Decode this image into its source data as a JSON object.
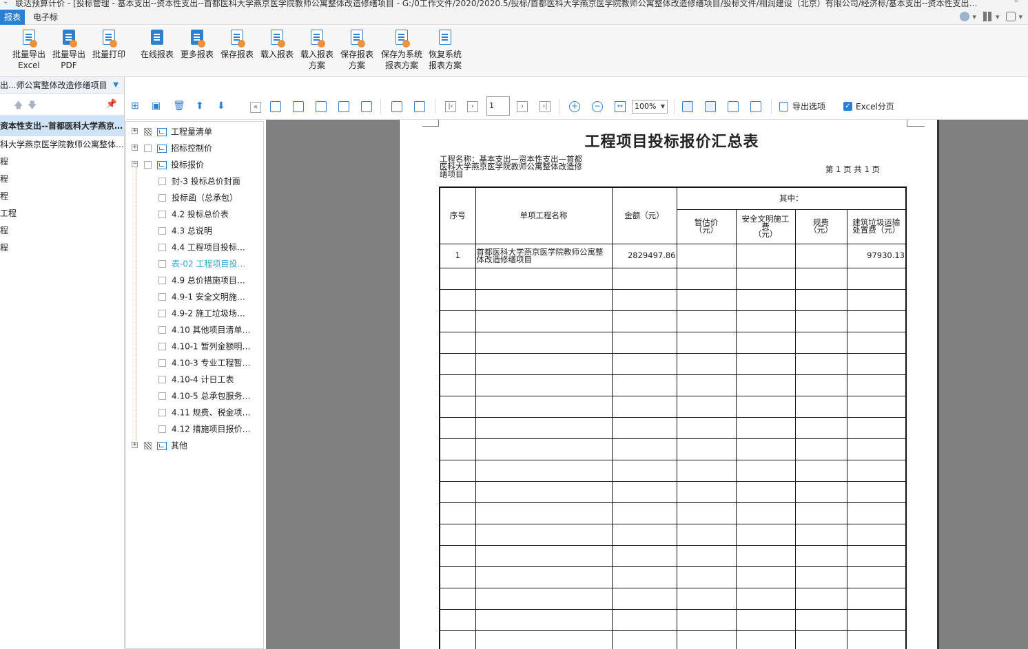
{
  "titlebar": {
    "title": "联达预算计价 - [投标管理 - 基本支出--资本性支出--首都医科大学燕京医学院教师公寓整体改造修缮项目 - G:/0工作文件/2020/2020.5/投标/首都医科大学燕京医学院教师公寓整体改造修缮项目/投标文件/相润建设（北京）有限公司/经济标/基本支出--资本性支出…",
    "minimize": "–"
  },
  "menu": {
    "tab_active": "报表",
    "tab_2": "电子标"
  },
  "ribbon": {
    "buttons": [
      {
        "label1": "批量导出",
        "label2": "Excel"
      },
      {
        "label1": "批量导出",
        "label2": "PDF"
      },
      {
        "label1": "批量打印",
        "label2": ""
      },
      {
        "label1": "在线报表",
        "label2": ""
      },
      {
        "label1": "更多报表",
        "label2": ""
      },
      {
        "label1": "保存报表",
        "label2": ""
      },
      {
        "label1": "载入报表",
        "label2": ""
      },
      {
        "label1": "载入报表",
        "label2": "方案"
      },
      {
        "label1": "保存报表",
        "label2": "方案"
      },
      {
        "label1": "保存为系统",
        "label2": "报表方案"
      },
      {
        "label1": "恢复系统",
        "label2": "报表方案"
      }
    ]
  },
  "left_panel": {
    "header": "出...师公寓整体改造修缮项目",
    "rows": [
      "资本性支出--首都医科大学燕京…",
      "科大学燕京医学院教师公寓整体…",
      "程",
      "程",
      "程",
      "工程",
      "程",
      "程"
    ]
  },
  "tree": {
    "nodes": [
      {
        "label": "工程量清单",
        "level": 0
      },
      {
        "label": "招标控制价",
        "level": 0
      },
      {
        "label": "投标报价",
        "level": 0
      },
      {
        "label": "封-3 投标总价封面",
        "level": 1
      },
      {
        "label": "投标函（总承包）",
        "level": 1
      },
      {
        "label": "4.2 投标总价表",
        "level": 1
      },
      {
        "label": "4.3 总说明",
        "level": 1
      },
      {
        "label": "4.4 工程项目投标…",
        "level": 1
      },
      {
        "label": "表-02 工程项目投…",
        "level": 1
      },
      {
        "label": "4.9 总价措施项目…",
        "level": 1
      },
      {
        "label": "4.9-1 安全文明施…",
        "level": 1
      },
      {
        "label": "4.9-2 施工垃圾场…",
        "level": 1
      },
      {
        "label": "4.10 其他项目清单…",
        "level": 1
      },
      {
        "label": "4.10-1 暂列金额明…",
        "level": 1
      },
      {
        "label": "4.10-3 专业工程暂…",
        "level": 1
      },
      {
        "label": "4.10-4 计日工表",
        "level": 1
      },
      {
        "label": "4.10-5 总承包服务…",
        "level": 1
      },
      {
        "label": "4.11 规费、税金项…",
        "level": 1
      },
      {
        "label": "4.12 措施项目报价…",
        "level": 1
      },
      {
        "label": "其他",
        "level": 0
      }
    ]
  },
  "preview_toolbar": {
    "page_input": "1",
    "zoom": "100%",
    "export_options": "导出选项",
    "excel_paging": "Excel分页"
  },
  "report": {
    "title": "工程项目投标报价汇总表",
    "project_name_line1": "工程名称：基本支出—资本性支出—首都",
    "project_name_line2": "医科大学燕京医学院教师公寓整体改造修",
    "project_name_line3": "缮项目",
    "page_info": "第  1  页 共  1  页",
    "headers": {
      "seq": "序号",
      "name": "单项工程名称",
      "amount": "金额（元）",
      "of_which": "其中：",
      "provisional": [
        "暂估价",
        "（元）"
      ],
      "safety": [
        "安全文明施工",
        "费",
        "（元）"
      ],
      "fees": [
        "规费",
        "（元）"
      ],
      "waste": [
        "建筑垃圾运输",
        "处置费（元）"
      ]
    },
    "row1": {
      "seq": "1",
      "name1": "首都医科大学燕京医学院教师公寓整",
      "name2": "体改造修缮项目",
      "amount": "2829497.86",
      "provisional": "",
      "safety": "",
      "fees": "",
      "waste": "97930.13"
    }
  }
}
